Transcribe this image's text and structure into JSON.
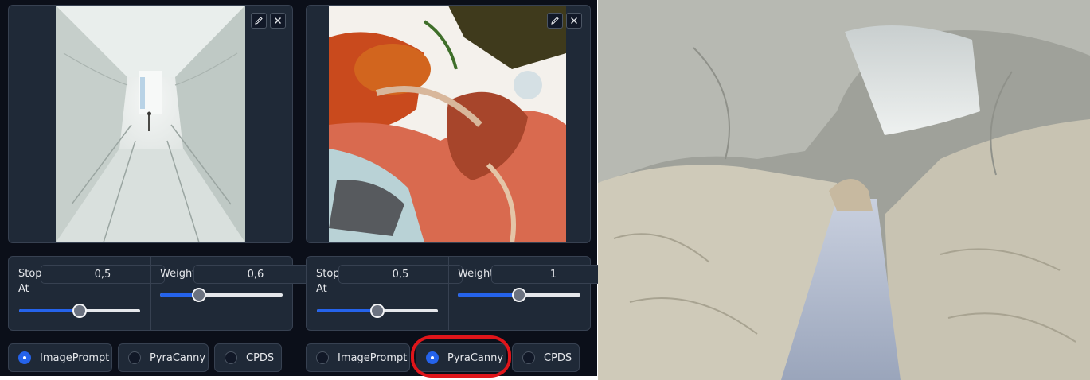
{
  "panels": [
    {
      "image_name": "white-fabric-tunnel-thumbnail",
      "stop_at": {
        "label": "Stop At",
        "label_line1": "Stop",
        "label_line2": "At",
        "value": "0,5",
        "level": 0.5
      },
      "weight": {
        "label": "Weight",
        "value": "0,6",
        "level": 0.32
      },
      "options": [
        {
          "label": "ImagePrompt",
          "selected": true
        },
        {
          "label": "PyraCanny",
          "selected": false
        },
        {
          "label": "CPDS",
          "selected": false
        }
      ]
    },
    {
      "image_name": "abstract-colorful-render-thumbnail",
      "stop_at": {
        "label": "Stop At",
        "label_line1": "Stop",
        "label_line2": "At",
        "value": "0,5",
        "level": 0.5
      },
      "weight": {
        "label": "Weight",
        "value": "1",
        "level": 0.5
      },
      "options": [
        {
          "label": "ImagePrompt",
          "selected": false
        },
        {
          "label": "PyraCanny",
          "selected": true
        },
        {
          "label": "CPDS",
          "selected": false
        }
      ]
    }
  ],
  "icons": {
    "edit": "pencil-icon",
    "remove": "close-icon"
  },
  "colors": {
    "background": "#0b0f19",
    "panel": "#1f2937",
    "accent": "#2563eb",
    "annotation": "#e0151a"
  },
  "result_image": "white-fabric-tunnel-result"
}
